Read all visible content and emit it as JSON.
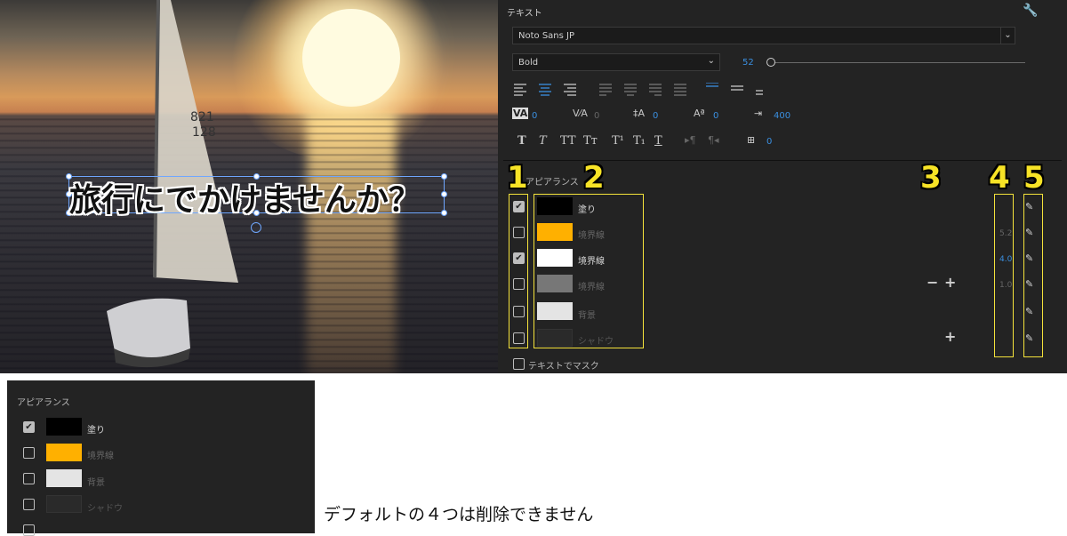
{
  "video": {
    "caption": "旅行にでかけませんか？",
    "sail_number_top": "821",
    "sail_number_bottom": "128"
  },
  "panel": {
    "title": "テキスト",
    "font_family": "Noto Sans JP",
    "font_style": "Bold",
    "font_size": "52",
    "tracking_kerning": "0",
    "kerning": "0",
    "leading": "0",
    "baseline_shift": "0",
    "tsume": "400",
    "tab_width": "0",
    "appearance_label": "アピアランス",
    "layers": [
      {
        "checked": true,
        "color": "#000000",
        "label": "塗り",
        "value": "",
        "active": true
      },
      {
        "checked": false,
        "color": "#ffb000",
        "label": "境界線",
        "value": "5.2",
        "active": false
      },
      {
        "checked": true,
        "color": "#ffffff",
        "label": "境界線",
        "value": "4.0",
        "active": true
      },
      {
        "checked": false,
        "color": "#777777",
        "label": "境界線",
        "value": "1.0",
        "active": false
      },
      {
        "checked": false,
        "color": "#e4e4e4",
        "label": "背景",
        "value": "",
        "active": false
      },
      {
        "checked": false,
        "color": "#2a2a2a",
        "label": "シャドウ",
        "value": "",
        "active": false
      }
    ],
    "mask_label": "テキストでマスク",
    "callouts": [
      "1",
      "2",
      "3",
      "4",
      "5"
    ]
  },
  "panel2": {
    "title": "アピアランス",
    "layers": [
      {
        "checked": true,
        "color": "#000000",
        "label": "塗り",
        "active": true
      },
      {
        "checked": false,
        "color": "#ffb000",
        "label": "境界線",
        "active": false
      },
      {
        "checked": false,
        "color": "#e4e4e4",
        "label": "背景",
        "active": false
      },
      {
        "checked": false,
        "color": "#2a2a2a",
        "label": "シャドウ",
        "active": false
      }
    ]
  },
  "note": "デフォルトの４つは削除できません"
}
